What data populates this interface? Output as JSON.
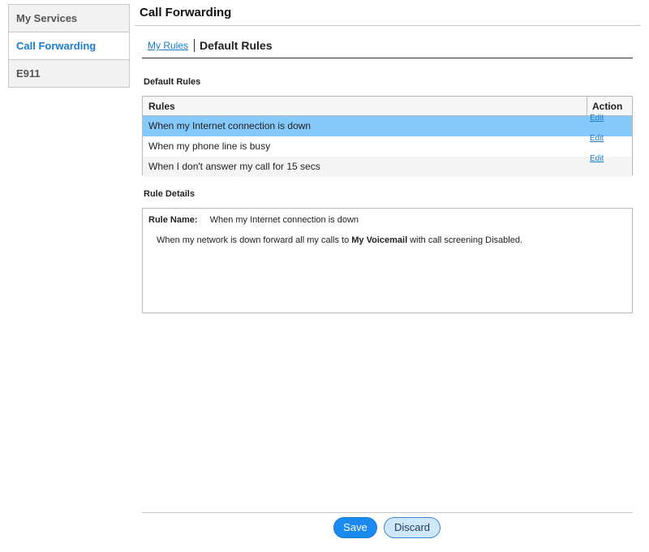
{
  "sidebar": {
    "items": [
      {
        "label": "My Services"
      },
      {
        "label": "Call Forwarding"
      },
      {
        "label": "E911"
      }
    ]
  },
  "header": {
    "title": "Call Forwarding"
  },
  "breadcrumb": {
    "link": "My Rules",
    "current": "Default Rules"
  },
  "default_rules": {
    "section_title": "Default Rules",
    "columns": {
      "rules": "Rules",
      "action": "Action"
    },
    "rows": [
      {
        "rule": "When my Internet connection is down",
        "action": "Edit",
        "selected": true
      },
      {
        "rule": "When my phone line is busy",
        "action": "Edit",
        "selected": false
      },
      {
        "rule": "When I don't answer my call for 15 secs",
        "action": "Edit",
        "selected": false
      }
    ]
  },
  "rule_details": {
    "section_title": "Rule Details",
    "name_label": "Rule Name:",
    "name_value": "When my Internet connection is down",
    "desc_prefix": "When my network is down forward all my calls to",
    "desc_target": "My Voicemail",
    "desc_suffix": "with call screening Disabled."
  },
  "footer": {
    "save_label": "Save",
    "discard_label": "Discard"
  },
  "colors": {
    "accent": "#1a7dd0",
    "selected_row": "#86c9fb",
    "save_button": "#1a8af0",
    "discard_button": "#cfe6fb"
  }
}
